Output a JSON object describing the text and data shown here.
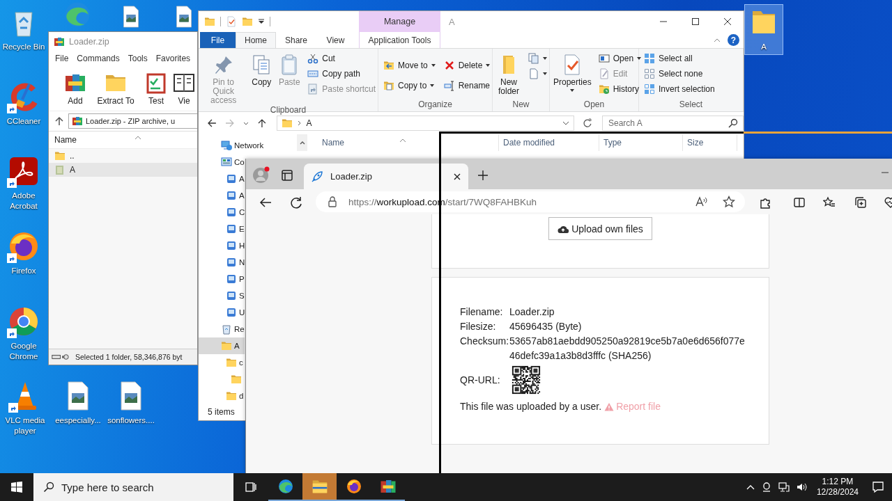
{
  "desktop": {
    "icons": [
      {
        "label": "Recycle Bin",
        "kind": "recycle",
        "shortcut": false,
        "selected": false
      },
      {
        "kind": "edge",
        "shortcut": false,
        "selected": false
      },
      {
        "kind": "image",
        "shortcut": false,
        "selected": false
      },
      {
        "kind": "image",
        "shortcut": false,
        "selected": false
      },
      {
        "label": "CCleaner",
        "kind": "cleaner",
        "shortcut": true,
        "selected": false
      },
      {
        "label": "Adobe Acrobat",
        "kind": "pdf",
        "shortcut": true,
        "selected": false
      },
      {
        "label": "Firefox",
        "kind": "firefox",
        "shortcut": true,
        "selected": false
      },
      {
        "label": "Google Chrome",
        "kind": "chrome",
        "shortcut": true,
        "selected": false
      },
      {
        "label": "VLC media player",
        "kind": "cone",
        "shortcut": true,
        "selected": false
      },
      {
        "label": "eespecially...",
        "kind": "image",
        "shortcut": false,
        "selected": false
      },
      {
        "label": "sonflowers....",
        "kind": "image",
        "shortcut": false,
        "selected": false
      },
      {
        "label": "A",
        "kind": "folder",
        "shortcut": false,
        "selected": true
      }
    ]
  },
  "winrar": {
    "title": "Loader.zip",
    "menu": [
      "File",
      "Commands",
      "Tools",
      "Favorites"
    ],
    "tools": [
      {
        "label": "Add"
      },
      {
        "label": "Extract To"
      },
      {
        "label": "Test"
      },
      {
        "label": "Vie"
      }
    ],
    "path": "Loader.zip - ZIP archive, u",
    "column": "Name",
    "rows": [
      {
        "name": "..",
        "selected": false
      },
      {
        "name": "A",
        "selected": true
      }
    ],
    "status": "Selected 1 folder, 58,346,876 byt"
  },
  "explorer": {
    "title": "A",
    "context_header": "Manage",
    "help_label": "?",
    "tabs": [
      {
        "label": "File",
        "kind": "file",
        "selected": false
      },
      {
        "label": "Home",
        "kind": "tab",
        "selected": true
      },
      {
        "label": "Share",
        "kind": "tab",
        "selected": false
      },
      {
        "label": "View",
        "kind": "tab",
        "selected": false
      },
      {
        "label": "Application Tools",
        "kind": "context",
        "selected": false
      }
    ],
    "ribbon": [
      {
        "name": "Clipboard",
        "items": [
          {
            "kind": "large",
            "label": "Pin to Quick access",
            "disabled": true,
            "dropdown": false
          },
          {
            "kind": "large",
            "label": "Copy",
            "disabled": false,
            "dropdown": false
          },
          {
            "kind": "large",
            "label": "Paste",
            "disabled": true,
            "dropdown": false
          },
          {
            "kind": "small",
            "label": "Cut",
            "disabled": false,
            "dropdown": false
          },
          {
            "kind": "small",
            "label": "Copy path",
            "disabled": false,
            "dropdown": false
          },
          {
            "kind": "small",
            "label": "Paste shortcut",
            "disabled": true,
            "dropdown": false
          }
        ]
      },
      {
        "name": "Organize",
        "items": [
          {
            "kind": "small",
            "label": "Move to",
            "disabled": false,
            "dropdown": true
          },
          {
            "kind": "small",
            "label": "Copy to",
            "disabled": false,
            "dropdown": true
          },
          {
            "kind": "small",
            "label": "Delete",
            "disabled": false,
            "dropdown": true
          },
          {
            "kind": "small",
            "label": "Rename",
            "disabled": false,
            "dropdown": false
          }
        ]
      },
      {
        "name": "New",
        "items": [
          {
            "kind": "large",
            "label": "New folder",
            "disabled": false,
            "dropdown": false
          },
          {
            "kind": "icon",
            "disabled": false,
            "dropdown": true
          },
          {
            "kind": "icon",
            "disabled": false,
            "dropdown": true
          }
        ]
      },
      {
        "name": "Open",
        "items": [
          {
            "kind": "large",
            "label": "Properties",
            "disabled": false,
            "dropdown": true
          },
          {
            "kind": "small",
            "label": "Open",
            "disabled": false,
            "dropdown": true
          },
          {
            "kind": "small",
            "label": "Edit",
            "disabled": true,
            "dropdown": false
          },
          {
            "kind": "small",
            "label": "History",
            "disabled": false,
            "dropdown": false
          }
        ]
      },
      {
        "name": "Select",
        "items": [
          {
            "kind": "small",
            "label": "Select all",
            "disabled": false,
            "dropdown": false
          },
          {
            "kind": "small",
            "label": "Select none",
            "disabled": false,
            "dropdown": false
          },
          {
            "kind": "small",
            "label": "Invert selection",
            "disabled": false,
            "dropdown": false
          }
        ]
      }
    ],
    "address": "A",
    "search_placeholder": "Search A",
    "nav": [
      {
        "label": "Network",
        "kind": "network",
        "selected": false
      },
      {
        "label": "Co",
        "kind": "control",
        "selected": false,
        "children": [
          {
            "label": "A",
            "kind": "applet",
            "selected": false
          },
          {
            "label": "A",
            "kind": "applet",
            "selected": false
          },
          {
            "label": "C",
            "kind": "applet",
            "selected": false
          },
          {
            "label": "E",
            "kind": "applet",
            "selected": false
          },
          {
            "label": "H",
            "kind": "applet",
            "selected": false
          },
          {
            "label": "N",
            "kind": "applet",
            "selected": false
          },
          {
            "label": "P",
            "kind": "applet",
            "selected": false
          },
          {
            "label": "S",
            "kind": "applet",
            "selected": false
          },
          {
            "label": "U",
            "kind": "applet",
            "selected": false
          }
        ]
      },
      {
        "label": "Re",
        "kind": "recycle",
        "selected": false
      },
      {
        "label": "A",
        "kind": "folder",
        "selected": true,
        "children": [
          {
            "label": "c",
            "kind": "folder",
            "selected": false,
            "children": [
              {
                "kind": "folder",
                "selected": false
              }
            ]
          },
          {
            "label": "d",
            "kind": "folder",
            "selected": false
          }
        ]
      }
    ],
    "columns": [
      {
        "label": "Name",
        "sorted": true
      },
      {
        "label": "Date modified",
        "sorted": false
      },
      {
        "label": "Type",
        "sorted": false
      },
      {
        "label": "Size",
        "sorted": false
      }
    ],
    "status": "5 items"
  },
  "browser": {
    "tabs": [
      {
        "title": "Loader.zip",
        "selected": true
      }
    ],
    "url": "https://**workupload.com**/start/7WQ8FAHBKuh",
    "upload_button": "Upload own files",
    "details": [
      {
        "kind": "text",
        "label": "Filename:",
        "value": "Loader.zip"
      },
      {
        "kind": "text",
        "label": "Filesize:",
        "value": "45696435 (Byte)"
      },
      {
        "kind": "text",
        "label": "Checksum:",
        "value": "53657ab81aebdd905250a92819ce5b7a0e6d656f077e46defc39a1a3b8d3fffc (SHA256)"
      },
      {
        "kind": "qr",
        "label": "QR-URL:"
      }
    ],
    "note": "This file was uploaded by a user.",
    "report_link": "Report file"
  },
  "taskbar": {
    "search_placeholder": "Type here to search",
    "apps": [
      {
        "kind": "edge",
        "flashing": false
      },
      {
        "kind": "explorer",
        "flashing": true
      },
      {
        "kind": "firefox",
        "flashing": false
      },
      {
        "kind": "winrar",
        "flashing": false
      }
    ],
    "time": "1:12 PM",
    "date": "12/28/2024"
  }
}
